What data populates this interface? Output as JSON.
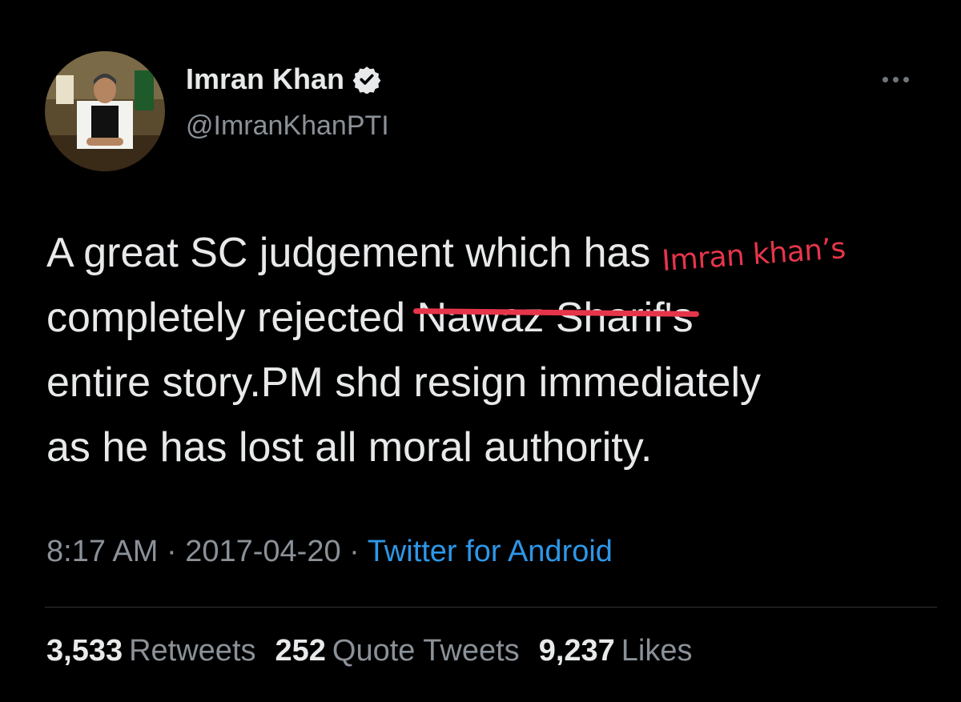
{
  "author": {
    "display_name": "Imran Khan",
    "handle": "@ImranKhanPTI",
    "verified": true
  },
  "tweet": {
    "lines": [
      "A great SC judgement which has",
      "completely rejected ",
      "entire story.PM shd resign immediately",
      "as he has lost all moral authority."
    ],
    "struck_text": "Nawaz Sharif's",
    "annotation": "Imran khan’s"
  },
  "meta": {
    "time": "8:17 AM",
    "separator": " · ",
    "date": "2017-04-20",
    "source": "Twitter for Android"
  },
  "stats": {
    "retweets_count": "3,533",
    "retweets_label": "Retweets",
    "quotes_count": "252",
    "quotes_label": "Quote Tweets",
    "likes_count": "9,237",
    "likes_label": "Likes"
  },
  "colors": {
    "background": "#000000",
    "text": "#e7e9ea",
    "muted": "#8b9198",
    "link": "#2d97e8",
    "annotation": "#e6354a"
  }
}
